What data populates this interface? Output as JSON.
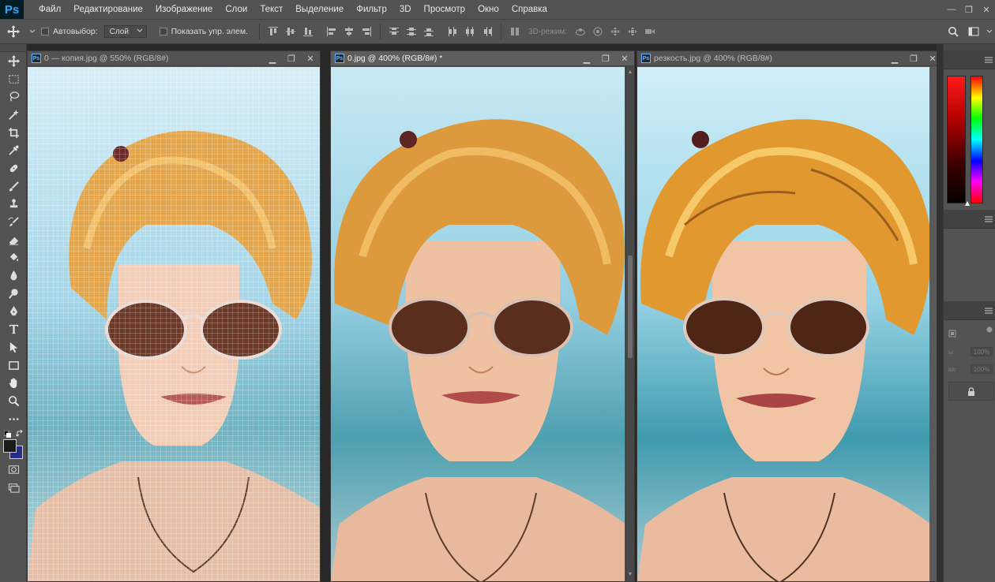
{
  "app": {
    "logo": "Ps"
  },
  "menu": [
    "Файл",
    "Редактирование",
    "Изображение",
    "Слои",
    "Текст",
    "Выделение",
    "Фильтр",
    "3D",
    "Просмотр",
    "Окно",
    "Справка"
  ],
  "window_controls": {
    "minimize": "—",
    "restore": "❐",
    "close": "✕"
  },
  "options": {
    "auto_select_label": "Автовыбор:",
    "auto_select_value": "Слой",
    "show_controls_label": "Показать упр. элем.",
    "mode_3d_label": "3D-режим:"
  },
  "documents": [
    {
      "title": "0 — копия.jpg @ 550% (RGB/8#)",
      "active": false
    },
    {
      "title": "0.jpg @ 400% (RGB/8#) *",
      "active": true
    },
    {
      "title": "резкость.jpg @ 400% (RGB/8#)",
      "active": false
    }
  ],
  "doc_controls": {
    "minimize": "▁",
    "restore": "❐",
    "close": "✕"
  },
  "colors": {
    "foreground": "#1b1b1b",
    "background": "#2a2c8a",
    "accent": "#31a8ff"
  },
  "panels": {
    "opacity_label": "ы:",
    "opacity_value": "100%",
    "fill_label": "ка:",
    "fill_value": "100%"
  },
  "icons": {
    "tools": [
      "move-icon",
      "marquee-icon",
      "lasso-icon",
      "magic-wand-icon",
      "crop-icon",
      "eyedropper-icon",
      "healing-brush-icon",
      "brush-icon",
      "clone-stamp-icon",
      "history-brush-icon",
      "eraser-icon",
      "paint-bucket-icon",
      "blur-icon",
      "dodge-icon",
      "pen-icon",
      "type-icon",
      "path-select-icon",
      "rectangle-icon",
      "hand-icon",
      "zoom-icon",
      "more-tools-icon"
    ]
  }
}
